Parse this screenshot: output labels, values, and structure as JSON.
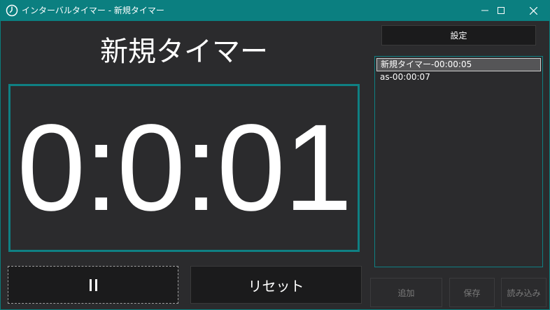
{
  "window": {
    "title": "インターバルタイマー - 新規タイマー",
    "accent_color": "#0b7f80",
    "controls": [
      "minimize-icon",
      "maximize-icon",
      "close-icon"
    ]
  },
  "timer": {
    "name": "新規タイマー",
    "display": "0:0:01"
  },
  "controls": {
    "pause_icon": "pause-icon",
    "reset_label": "リセット"
  },
  "sidebar": {
    "settings_label": "設定",
    "timers": [
      {
        "label": "新規タイマー-00:00:05",
        "selected": true
      },
      {
        "label": "as-00:00:07",
        "selected": false
      }
    ],
    "add_label": "追加",
    "save_label": "保存",
    "load_label": "読み込み"
  }
}
